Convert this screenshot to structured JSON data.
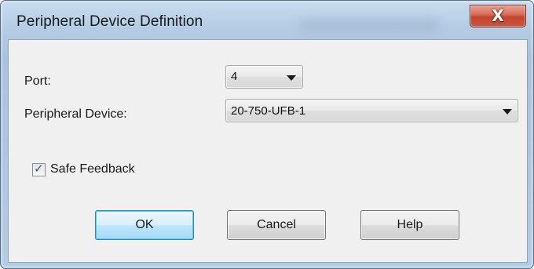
{
  "window": {
    "title": "Peripheral Device Definition",
    "close_glyph": "X"
  },
  "form": {
    "port_label": "Port:",
    "port_value": "4",
    "device_label": "Peripheral Device:",
    "device_value": "20-750-UFB-1",
    "safe_feedback_label": "Safe Feedback",
    "safe_feedback_checked": true,
    "check_glyph": "✓"
  },
  "buttons": {
    "ok": "OK",
    "cancel": "Cancel",
    "help": "Help"
  },
  "colors": {
    "frame": "#b3cce4",
    "client": "#f0f0f0",
    "close": "#c4452f",
    "default_button_border": "#3c7fb1"
  }
}
